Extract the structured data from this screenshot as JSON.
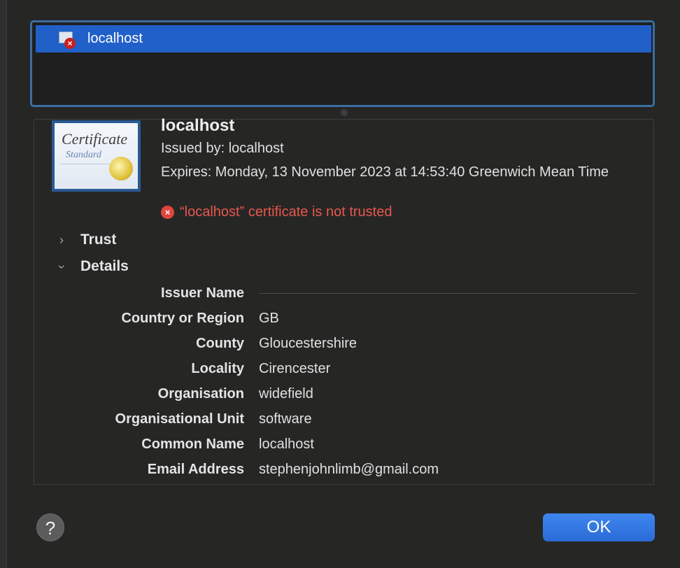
{
  "certificate_list": {
    "items": [
      {
        "label": "localhost",
        "icon": "certificate-error-icon",
        "selected": true
      }
    ]
  },
  "certificate": {
    "title": "localhost",
    "image_text_main": "Certificate",
    "image_text_sub": "Standard",
    "issued_by": "Issued by: localhost",
    "expires": "Expires: Monday, 13 November 2023 at 14:53:40 Greenwich Mean Time",
    "warning": "“localhost” certificate is not trusted",
    "warning_color": "#e8574e"
  },
  "sections": {
    "trust": {
      "label": "Trust",
      "expanded": false
    },
    "details": {
      "label": "Details",
      "expanded": true
    }
  },
  "details": {
    "issuer_heading": "Issuer Name",
    "fields": [
      {
        "key": "Country or Region",
        "value": "GB"
      },
      {
        "key": "County",
        "value": "Gloucestershire"
      },
      {
        "key": "Locality",
        "value": "Cirencester"
      },
      {
        "key": "Organisation",
        "value": "widefield"
      },
      {
        "key": "Organisational Unit",
        "value": "software"
      },
      {
        "key": "Common Name",
        "value": "localhost"
      },
      {
        "key": "Email Address",
        "value": "stephenjohnlimb@gmail.com"
      }
    ]
  },
  "buttons": {
    "help": "?",
    "ok": "OK"
  },
  "colors": {
    "selection": "#2160c9",
    "accent_button": "#2f74e0",
    "error": "#e0443e"
  }
}
